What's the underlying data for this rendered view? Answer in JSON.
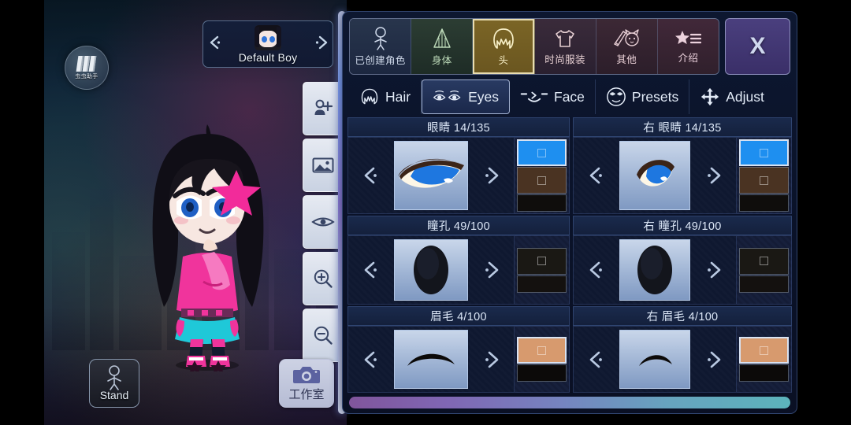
{
  "app": {
    "assistant_label": "虫虫助手",
    "assistant_icon": "books-icon"
  },
  "viewport": {
    "character_selector": {
      "prev_icon": "chevron-left-icon",
      "next_icon": "chevron-right-icon",
      "name": "Default Boy",
      "avatar_icon": "character-face-icon"
    },
    "tools": [
      {
        "name": "add-character",
        "icon": "person-add-icon"
      },
      {
        "name": "background",
        "icon": "image-icon"
      },
      {
        "name": "preview",
        "icon": "eye-icon"
      },
      {
        "name": "zoom-in",
        "icon": "zoom-in-icon"
      },
      {
        "name": "zoom-out",
        "icon": "zoom-out-icon"
      }
    ],
    "pose_button": {
      "label": "Stand",
      "icon": "standing-person-icon"
    },
    "studio_button": {
      "label": "工作室",
      "icon": "camera-icon"
    }
  },
  "panel": {
    "close_label": "X",
    "close_icon": "close-icon",
    "tabs": [
      {
        "label": "已创建角色",
        "icon": "created-character-icon",
        "selected": false
      },
      {
        "label": "身体",
        "icon": "body-icon",
        "selected": false
      },
      {
        "label": "头",
        "icon": "head-hair-icon",
        "selected": true
      },
      {
        "label": "时尚服装",
        "icon": "tshirt-icon",
        "selected": false
      },
      {
        "label": "其他",
        "icon": "sword-cat-icon",
        "selected": false
      },
      {
        "label": "介绍",
        "icon": "star-list-icon",
        "selected": false
      }
    ],
    "subtabs": [
      {
        "label": "Hair",
        "icon": "hair-icon",
        "selected": false
      },
      {
        "label": "Eyes",
        "icon": "eyes-icon",
        "selected": true
      },
      {
        "label": "Face",
        "icon": "face-icon",
        "selected": false
      },
      {
        "label": "Presets",
        "icon": "presets-icon",
        "selected": false
      },
      {
        "label": "Adjust",
        "icon": "adjust-icon",
        "selected": false
      }
    ],
    "items": [
      {
        "title": "眼睛 14/135",
        "index": 14,
        "total": 135,
        "preview_icon": "eye-shape-blue-icon",
        "swatches": [
          {
            "color": "#1e8ff0",
            "active": true,
            "size": "tall"
          },
          {
            "color": "#4a3322",
            "active": false,
            "size": "tall"
          },
          {
            "color": "#0f0d0c",
            "active": false,
            "size": "short"
          }
        ]
      },
      {
        "title": "右 眼睛 14/135",
        "index": 14,
        "total": 135,
        "preview_icon": "eye-shape-blue-icon",
        "swatches": [
          {
            "color": "#1e8ff0",
            "active": true,
            "size": "tall"
          },
          {
            "color": "#4a3322",
            "active": false,
            "size": "tall"
          },
          {
            "color": "#0f0d0c",
            "active": false,
            "size": "short"
          }
        ]
      },
      {
        "title": "瞳孔 49/100",
        "index": 49,
        "total": 100,
        "preview_icon": "pupil-oval-icon",
        "swatches": [
          {
            "color": "#1a1814",
            "active": false,
            "size": "tall"
          },
          {
            "color": "#14110f",
            "active": false,
            "size": "short"
          }
        ]
      },
      {
        "title": "右 瞳孔 49/100",
        "index": 49,
        "total": 100,
        "preview_icon": "pupil-oval-icon",
        "swatches": [
          {
            "color": "#1a1814",
            "active": false,
            "size": "tall"
          },
          {
            "color": "#14110f",
            "active": false,
            "size": "short"
          }
        ]
      },
      {
        "title": "眉毛 4/100",
        "index": 4,
        "total": 100,
        "preview_icon": "eyebrow-arc-icon",
        "swatches": [
          {
            "color": "#d79a6e",
            "active": true,
            "size": "tall"
          },
          {
            "color": "#0c0a09",
            "active": false,
            "size": "short"
          }
        ]
      },
      {
        "title": "右 眉毛 4/100",
        "index": 4,
        "total": 100,
        "preview_icon": "eyebrow-arc-icon",
        "swatches": [
          {
            "color": "#d79a6e",
            "active": true,
            "size": "tall"
          },
          {
            "color": "#0c0a09",
            "active": false,
            "size": "short"
          }
        ]
      }
    ],
    "nav_prev_icon": "chevron-left-icon",
    "nav_next_icon": "chevron-right-icon"
  },
  "colors": {
    "panel_bg": "#0a1228",
    "accent_selected_tab": "#7b6526",
    "close_button": "#4a3f7e",
    "eye_blue": "#1e8ff0",
    "brow_tan": "#d79a6e",
    "edge_gradient_start": "#8b5ba6",
    "edge_gradient_end": "#63c2c9"
  }
}
